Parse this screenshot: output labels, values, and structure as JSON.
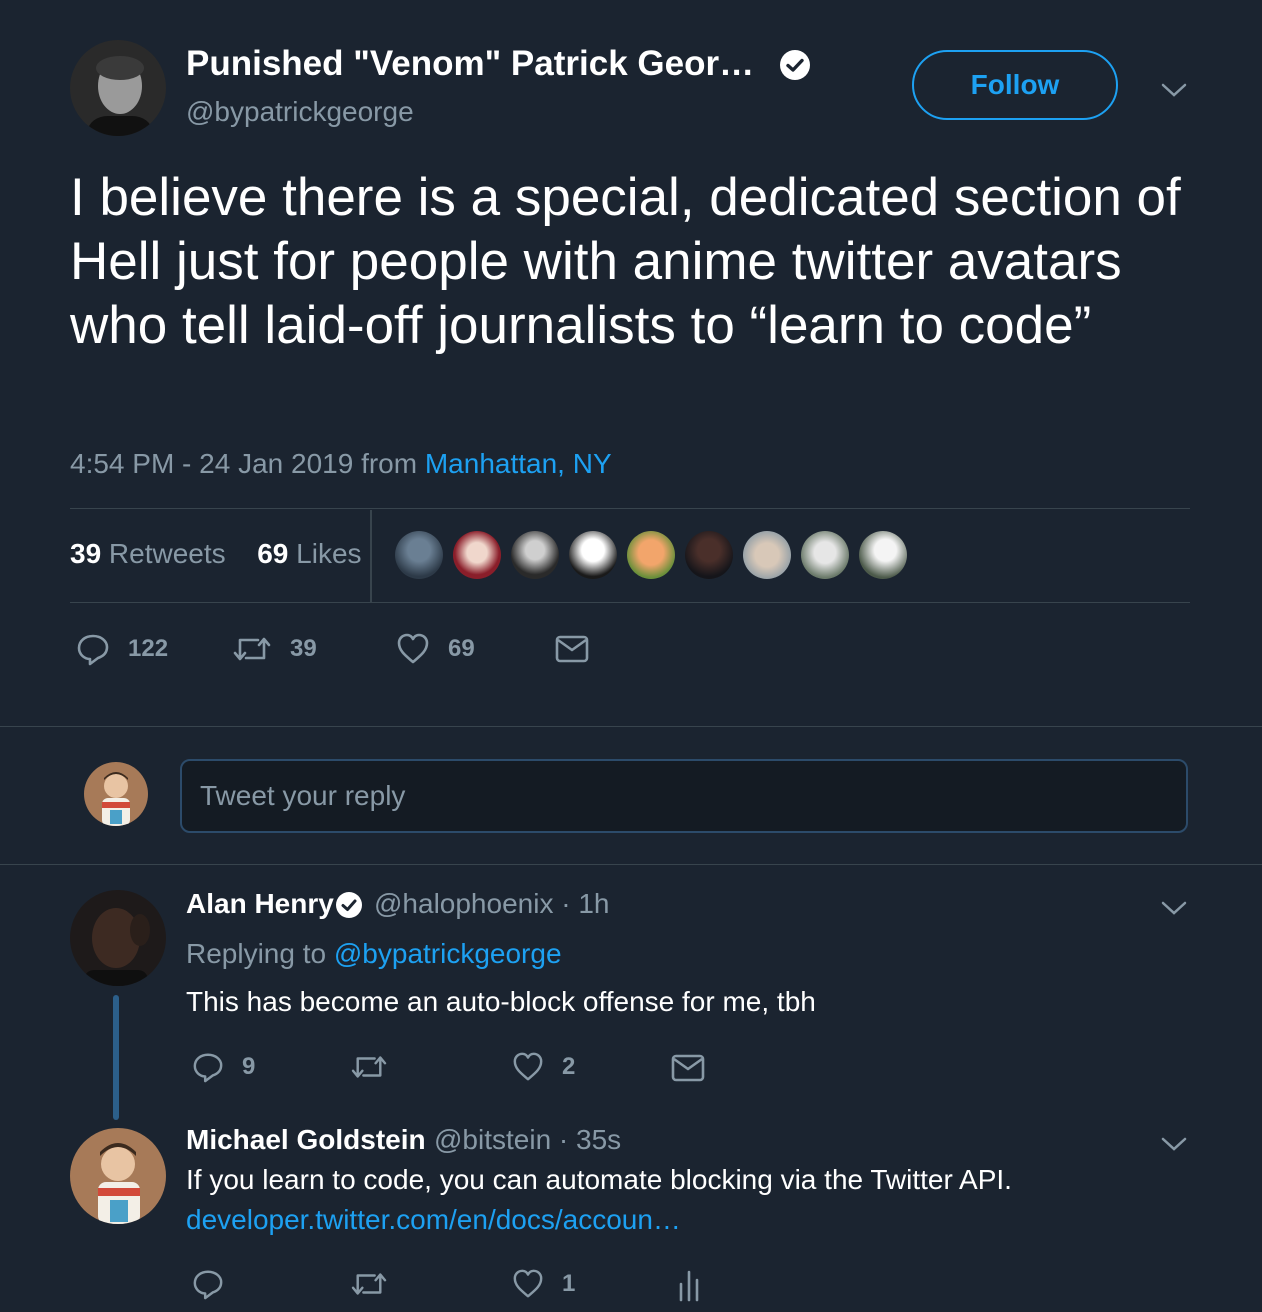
{
  "main_tweet": {
    "author_name": "Punished \"Venom\" Patrick Geor…",
    "handle": "@bypatrickgeorge",
    "follow_label": "Follow",
    "text": "I believe there is a special, dedicated section of Hell just for people with anime twitter avatars who tell laid-off journalists to “learn to code”",
    "timestamp": "4:54 PM - 24 Jan 2019 from ",
    "location": "Manhattan, NY",
    "retweets_count": "39",
    "retweets_label": " Retweets",
    "likes_count": "69",
    "likes_label": " Likes",
    "actions": {
      "replies": "122",
      "retweets": "39",
      "likes": "69"
    }
  },
  "reply_box": {
    "placeholder": "Tweet your reply"
  },
  "replies": [
    {
      "name": "Alan Henry",
      "handle_time": "@halophoenix · 1h",
      "replying_prefix": "Replying to ",
      "replying_to": "@bypatrickgeorge",
      "text": "This has become an auto-block offense for me, tbh",
      "actions": {
        "replies": "9",
        "retweets": "",
        "likes": "2"
      }
    },
    {
      "name": "Michael Goldstein",
      "handle_time": "@bitstein · 35s",
      "text": "If you learn to code, you can automate blocking via the Twitter API.",
      "link": "developer.twitter.com/en/docs/accoun…",
      "actions": {
        "replies": "",
        "retweets": "",
        "likes": "1"
      }
    }
  ],
  "colors": {
    "background": "#1b2430",
    "accent": "#1da1f2",
    "muted": "#8899a6",
    "divider": "#38444d"
  }
}
